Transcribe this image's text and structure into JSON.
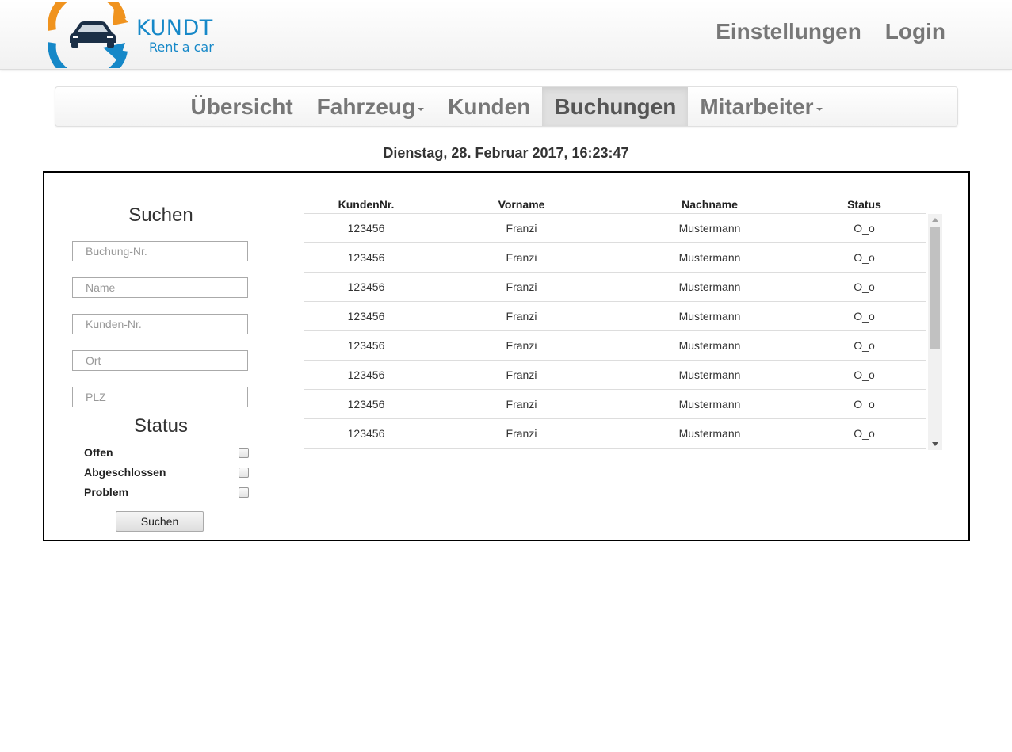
{
  "brand": {
    "name": "KUNDT",
    "tagline": "Rent a car"
  },
  "top_nav": {
    "settings": "Einstellungen",
    "login": "Login"
  },
  "main_nav": [
    {
      "label": "Übersicht",
      "dropdown": false,
      "active": false
    },
    {
      "label": "Fahrzeug",
      "dropdown": true,
      "active": false
    },
    {
      "label": "Kunden",
      "dropdown": false,
      "active": false
    },
    {
      "label": "Buchungen",
      "dropdown": false,
      "active": true
    },
    {
      "label": "Mitarbeiter",
      "dropdown": true,
      "active": false
    }
  ],
  "datetime": "Dienstag, 28. Februar 2017, 16:23:47",
  "search": {
    "title": "Suchen",
    "fields": [
      {
        "placeholder": "Buchung-Nr.",
        "value": ""
      },
      {
        "placeholder": "Name",
        "value": ""
      },
      {
        "placeholder": "Kunden-Nr.",
        "value": ""
      },
      {
        "placeholder": "Ort",
        "value": ""
      },
      {
        "placeholder": "PLZ",
        "value": ""
      }
    ],
    "status_title": "Status",
    "status_options": [
      {
        "label": "Offen",
        "checked": false
      },
      {
        "label": "Abgeschlossen",
        "checked": false
      },
      {
        "label": "Problem",
        "checked": false
      }
    ],
    "button_label": "Suchen"
  },
  "table": {
    "headers": [
      "KundenNr.",
      "Vorname",
      "Nachname",
      "Status"
    ],
    "rows": [
      [
        "123456",
        "Franzi",
        "Mustermann",
        "O_o"
      ],
      [
        "123456",
        "Franzi",
        "Mustermann",
        "O_o"
      ],
      [
        "123456",
        "Franzi",
        "Mustermann",
        "O_o"
      ],
      [
        "123456",
        "Franzi",
        "Mustermann",
        "O_o"
      ],
      [
        "123456",
        "Franzi",
        "Mustermann",
        "O_o"
      ],
      [
        "123456",
        "Franzi",
        "Mustermann",
        "O_o"
      ],
      [
        "123456",
        "Franzi",
        "Mustermann",
        "O_o"
      ],
      [
        "123456",
        "Franzi",
        "Mustermann",
        "O_o"
      ]
    ]
  },
  "colors": {
    "brand_blue": "#1688c8",
    "brand_orange": "#f0931e",
    "nav_text": "#777777"
  }
}
